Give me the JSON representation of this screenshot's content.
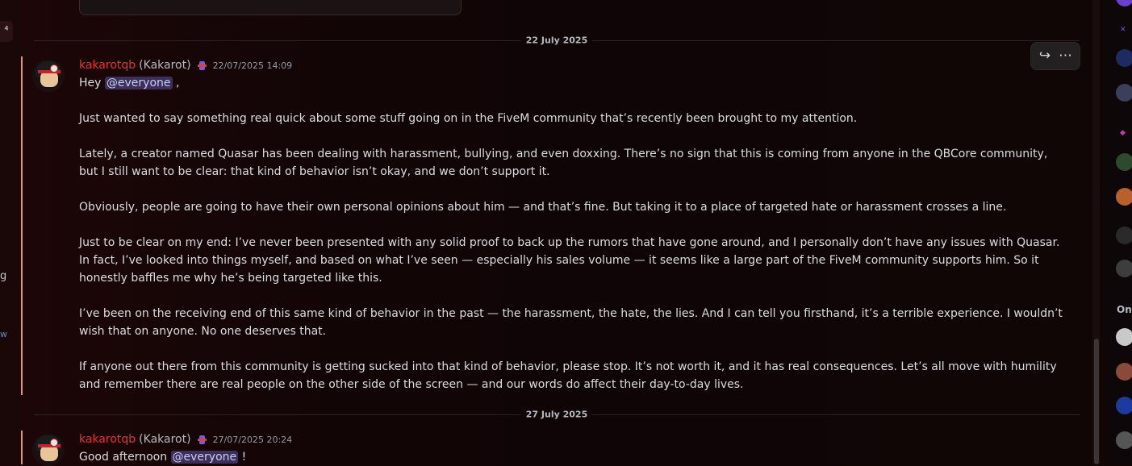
{
  "left_sidebar": {
    "button_icon": "add-icon",
    "button_glyph": "⁴",
    "fragment_g": "g",
    "fragment_w": "w"
  },
  "dates": {
    "first": "22 July 2025",
    "second": "27 July 2025"
  },
  "message1": {
    "username": "kakarotqb",
    "display_name": "(Kakarot)",
    "timestamp": "22/07/2025 14:09",
    "greeting": "Hey",
    "mention": "@everyone",
    "greeting_tail": ",",
    "paragraphs": [
      "Just wanted to say something real quick about some stuff going on in the FiveM community that’s recently been brought to my attention.",
      "Lately, a creator named Quasar has been dealing with harassment, bullying, and even doxxing. There’s no sign that this is coming from anyone in the QBCore community, but I still want to be clear: that kind of behavior isn’t okay, and we don’t support it.",
      "Obviously, people are going to have their own personal opinions about him — and that’s fine. But taking it to a place of targeted hate or harassment crosses a line.",
      "Just to be clear on my end: I’ve never been presented with any solid proof to back up the rumors that have gone around, and I personally don’t have any issues with Quasar. In fact, I’ve looked into things myself, and based on what I’ve seen — especially his sales volume — it seems like a large part of the FiveM community supports him. So it honestly baffles me why he’s being targeted like this.",
      "I’ve been on the receiving end of this same kind of behavior in the past — the harassment, the hate, the lies. And I can tell you firsthand, it’s a terrible experience. I wouldn’t wish that on anyone. No one deserves that.",
      "If anyone out there from this community is getting sucked into that kind of behavior, please stop. It’s not worth it, and it has real consequences. Let’s all move with humility and remember there are real people on the other side of the screen — and our words do affect their day-to-day lives."
    ]
  },
  "message2": {
    "username": "kakarotqb",
    "display_name": "(Kakarot)",
    "timestamp": "27/07/2025 20:24",
    "greeting": "Good afternoon",
    "mention": "@everyone",
    "greeting_tail": "!"
  },
  "hover_toolbar": {
    "forward_icon": "↪",
    "more_icon": "⋯"
  },
  "member_list": {
    "online_label": "On",
    "avatar_colors": [
      "#6a3fd0",
      "#1f2a63",
      "#3a3f5a",
      "#2e4a2e",
      "#b8612a",
      "#2a2a2a",
      "#3d3d3d",
      "#c9c9c9",
      "#8a4a3a",
      "#1d3aa0",
      "#555555"
    ]
  }
}
